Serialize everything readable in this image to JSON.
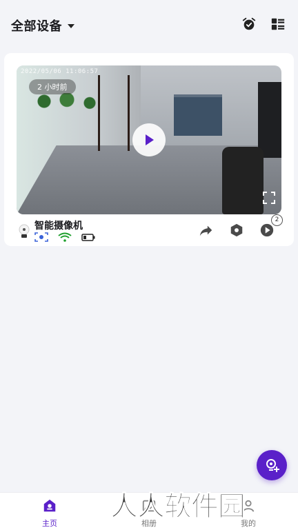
{
  "header": {
    "title": "全部设备",
    "icons": [
      "alarm-clock-icon",
      "grid-list-icon"
    ]
  },
  "device": {
    "timestamp": "2022/05/06 11:06:57",
    "time_ago": "2 小时前",
    "name": "智能摄像机",
    "clip_count": "2",
    "status_icons": [
      "face-scan-icon",
      "wifi-icon",
      "battery-icon"
    ],
    "actions": [
      "share-icon",
      "settings-hex-icon",
      "playback-icon"
    ]
  },
  "nav": {
    "items": [
      {
        "label": "主页",
        "icon": "home-camera-icon",
        "active": true
      },
      {
        "label": "相册",
        "icon": "album-icon",
        "active": false
      },
      {
        "label": "我的",
        "icon": "profile-icon",
        "active": false
      }
    ]
  },
  "watermark": "人人软件园",
  "colors": {
    "accent": "#5a20c9",
    "background": "#f3f4f8",
    "wifi": "#1fa02e"
  }
}
